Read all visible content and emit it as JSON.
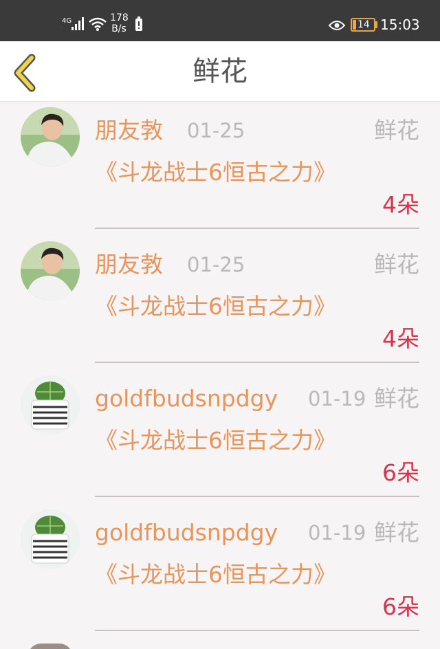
{
  "status_bar": {
    "network": "4G",
    "speed_value": "178",
    "speed_unit": "B/s",
    "battery_level": "14",
    "time": "15:03"
  },
  "header": {
    "title": "鲜花",
    "back_icon": "chevron-left-icon"
  },
  "gifts": [
    {
      "user": "朋友㪍",
      "date": "01-25",
      "type": "鲜花",
      "book": "《斗龙战士6恒古之力》",
      "count": "4朵",
      "avatar": "person-photo"
    },
    {
      "user": "朋友㪍",
      "date": "01-25",
      "type": "鲜花",
      "book": "《斗龙战士6恒古之力》",
      "count": "4朵",
      "avatar": "person-photo"
    },
    {
      "user": "goldfbudsnpdgy",
      "date": "01-19",
      "type": "鲜花",
      "book": "《斗龙战士6恒古之力》",
      "count": "6朵",
      "avatar": "cactus-photo"
    },
    {
      "user": "goldfbudsnpdgy",
      "date": "01-19",
      "type": "鲜花",
      "book": "《斗龙战士6恒古之力》",
      "count": "6朵",
      "avatar": "cactus-photo"
    }
  ],
  "colors": {
    "accent_orange": "#e8945a",
    "count_red": "#d8344d",
    "muted_gray": "#b9b9b9",
    "status_bar": "#3a3a3a",
    "back_icon_yellow": "#f3d34a"
  }
}
